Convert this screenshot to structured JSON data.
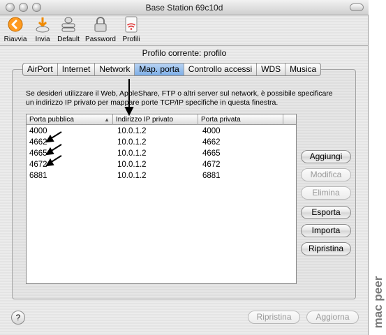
{
  "window": {
    "title": "Base Station 69c10d"
  },
  "toolbar": {
    "items": [
      {
        "label": "Riavvia",
        "icon": "restart-icon"
      },
      {
        "label": "Invia",
        "icon": "upload-icon"
      },
      {
        "label": "Default",
        "icon": "default-icon"
      },
      {
        "label": "Password",
        "icon": "lock-icon"
      },
      {
        "label": "Profili",
        "icon": "wireless-profiles-icon"
      }
    ]
  },
  "profile": {
    "current": "Profilo corrente: profilo"
  },
  "tabs": [
    {
      "label": "AirPort"
    },
    {
      "label": "Internet"
    },
    {
      "label": "Network"
    },
    {
      "label": "Map. porta",
      "active": true
    },
    {
      "label": "Controllo accessi"
    },
    {
      "label": "WDS"
    },
    {
      "label": "Musica"
    }
  ],
  "description": "Se desideri utilizzare il Web, AppleShare, FTP o altri server sul network, è possibile specificare un indirizzo IP privato per mappare porte TCP/IP specifiche in questa finestra.",
  "table": {
    "headers": [
      "Porta pubblica",
      "Indirizzo IP privato",
      "Porta privata"
    ],
    "rows": [
      [
        "4000",
        "10.0.1.2",
        "4000"
      ],
      [
        "4662",
        "10.0.1.2",
        "4662"
      ],
      [
        "4665",
        "10.0.1.2",
        "4665"
      ],
      [
        "4672",
        "10.0.1.2",
        "4672"
      ],
      [
        "6881",
        "10.0.1.2",
        "6881"
      ]
    ]
  },
  "side_buttons": {
    "add": "Aggiungi",
    "edit": "Modifica",
    "delete": "Elimina",
    "export": "Esporta",
    "import": "Importa",
    "restore": "Ripristina"
  },
  "footer": {
    "help": "?",
    "revert": "Ripristina",
    "update": "Aggiorna"
  },
  "watermark": "mac peer",
  "colors": {
    "active_tab": "#7daee6",
    "disabled_text": "#9a9a9a"
  }
}
